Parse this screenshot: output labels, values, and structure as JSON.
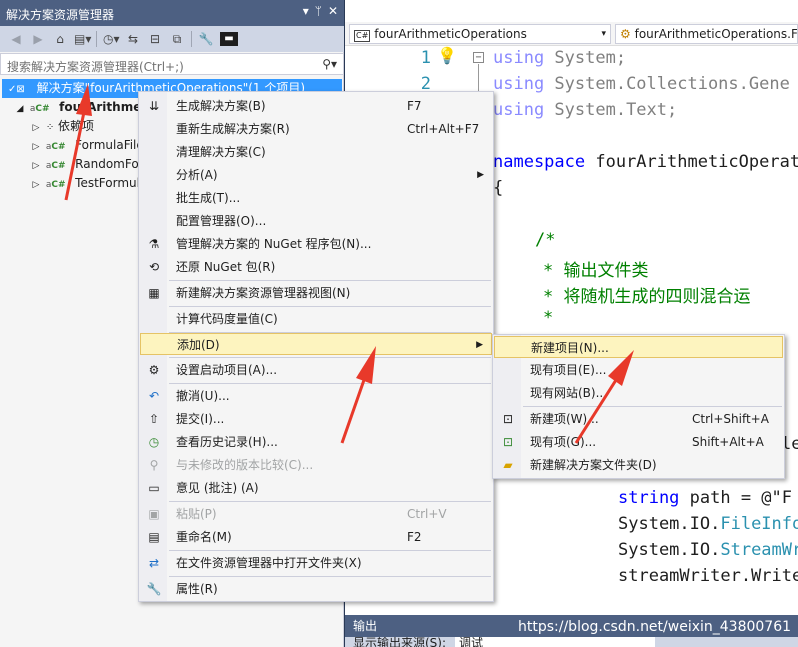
{
  "solution_explorer": {
    "title": "解决方案资源管理器",
    "title_buttons": [
      "▾",
      "📌",
      "✕"
    ],
    "search_placeholder": "搜索解决方案资源管理器(Ctrl+;)",
    "tree": {
      "solution": "解决方案\"fourArithmeticOperations\"(1 个项目)",
      "project": "fourArithmeticOperations",
      "dependencies": "依赖项",
      "files": [
        "FormulaFile",
        "RandomFor",
        "TestFormula"
      ]
    }
  },
  "editor": {
    "nav_left": "fourArithmeticOperations",
    "nav_right": "fourArithmeticOperations.Fo",
    "line_numbers": [
      "1",
      "2"
    ],
    "code": {
      "line1_kw": "using",
      "line1_rest": " System;",
      "line2_kw": "using",
      "line2_rest": " System.Collections.Gene",
      "line3_kw": "using",
      "line3_rest": " System.Text;",
      "ns_kw": "namespace",
      "ns_rest": " fourArithmeticOperat",
      "brace": "{",
      "c1": "/*",
      "c2": "* 输出文件类",
      "c3": "* 将随机生成的四则混合运",
      "c4": "*",
      "partial": "le",
      "l_path_kw": "string",
      "l_path_rest": " path = @\"F",
      "l_fi_pre": "System.IO.",
      "l_fi_ty": "FileInfo",
      "l_sw_pre": "System.IO.",
      "l_sw_ty": "StreamWr",
      "l_write": "streamWriter.Write"
    }
  },
  "output": {
    "title": "输出",
    "source_label": "显示输出来源(S):",
    "source_value": "调试"
  },
  "watermark": "https://blog.csdn.net/weixin_43800761",
  "context_menu": {
    "items": [
      {
        "label": "生成解决方案(B)",
        "shortcut": "F7",
        "icon": "build-icon"
      },
      {
        "label": "重新生成解决方案(R)",
        "shortcut": "Ctrl+Alt+F7",
        "icon": ""
      },
      {
        "label": "清理解决方案(C)",
        "shortcut": "",
        "icon": ""
      },
      {
        "label": "分析(A)",
        "shortcut": "",
        "icon": ""
      },
      {
        "label": "批生成(T)...",
        "shortcut": "",
        "icon": ""
      },
      {
        "label": "配置管理器(O)...",
        "shortcut": "",
        "icon": ""
      },
      {
        "label": "管理解决方案的 NuGet 程序包(N)...",
        "shortcut": "",
        "icon": "nuget-icon"
      },
      {
        "label": "还原 NuGet 包(R)",
        "shortcut": "",
        "icon": "restore-icon"
      },
      {
        "label": "新建解决方案资源管理器视图(N)",
        "shortcut": "",
        "icon": "new-view-icon"
      },
      {
        "label": "计算代码度量值(C)",
        "shortcut": "",
        "icon": ""
      },
      {
        "label": "添加(D)",
        "shortcut": "",
        "icon": ""
      },
      {
        "label": "设置启动项目(A)...",
        "shortcut": "",
        "icon": "gear-icon"
      },
      {
        "label": "撤消(U)...",
        "shortcut": "",
        "icon": "undo-icon"
      },
      {
        "label": "提交(I)...",
        "shortcut": "",
        "icon": "commit-icon"
      },
      {
        "label": "查看历史记录(H)...",
        "shortcut": "",
        "icon": "history-icon"
      },
      {
        "label": "与未修改的版本比较(C)...",
        "shortcut": "",
        "icon": "compare-icon"
      },
      {
        "label": "意见 (批注) (A)",
        "shortcut": "",
        "icon": "annotate-icon"
      },
      {
        "label": "粘贴(P)",
        "shortcut": "Ctrl+V",
        "icon": "paste-icon"
      },
      {
        "label": "重命名(M)",
        "shortcut": "F2",
        "icon": "rename-icon"
      },
      {
        "label": "在文件资源管理器中打开文件夹(X)",
        "shortcut": "",
        "icon": "open-folder-icon"
      },
      {
        "label": "属性(R)",
        "shortcut": "",
        "icon": "wrench-icon"
      }
    ]
  },
  "submenu": {
    "items": [
      {
        "label": "新建项目(N)...",
        "shortcut": ""
      },
      {
        "label": "现有项目(E)...",
        "shortcut": ""
      },
      {
        "label": "现有网站(B)...",
        "shortcut": ""
      },
      {
        "label": "新建项(W)...",
        "shortcut": "Ctrl+Shift+A"
      },
      {
        "label": "现有项(G)...",
        "shortcut": "Shift+Alt+A"
      },
      {
        "label": "新建解决方案文件夹(D)",
        "shortcut": ""
      }
    ]
  },
  "colors": {
    "selection": "#3399ff",
    "title_bar": "#4d6082",
    "highlight": "#fdf4bf",
    "arrow": "#e8392a"
  }
}
